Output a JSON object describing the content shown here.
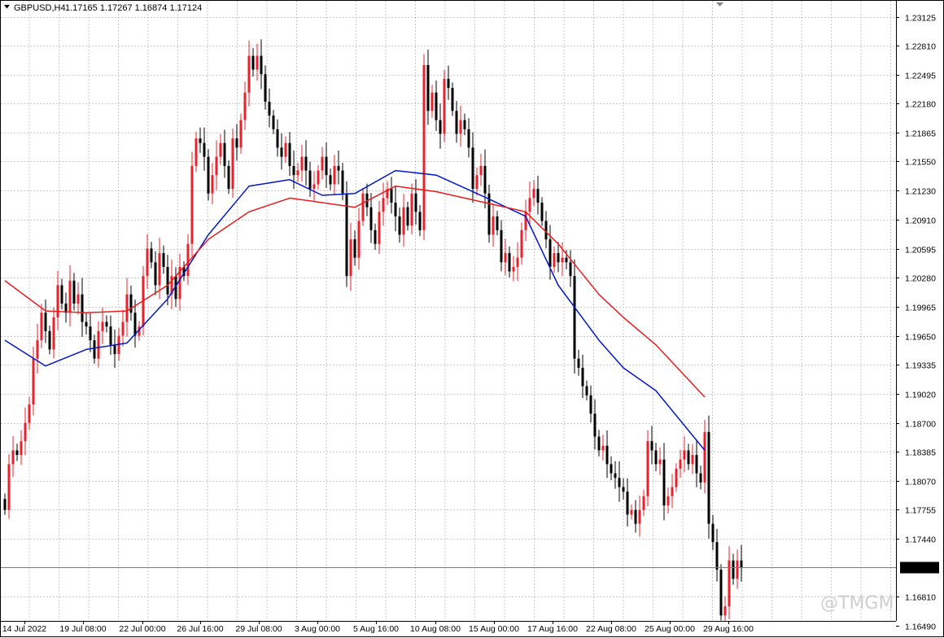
{
  "header": {
    "symbol": "GBPUSD,H4",
    "ohlc": "1.17165 1.17267 1.16874 1.17124"
  },
  "watermark": "@TMGM",
  "colors": {
    "bull": "#e8222c",
    "bear": "#000000",
    "ma_fast": "#0018c8",
    "ma_slow": "#e81c1c",
    "grid": "#c8c8c8",
    "axis": "#000000",
    "price_label_bg": "#000000",
    "price_label_text": "#ffffff"
  },
  "chart_data": {
    "type": "line",
    "title": "GBPUSD,H4",
    "ohlc_readout": {
      "open": 1.17165,
      "high": 1.17267,
      "low": 1.16874,
      "close": 1.17124
    },
    "current_price": "1.17124",
    "ylim": [
      1.1655,
      1.233
    ],
    "y_ticks": [
      "1.23125",
      "1.22810",
      "1.22495",
      "1.22180",
      "1.21865",
      "1.21550",
      "1.21230",
      "1.20910",
      "1.20595",
      "1.20280",
      "1.19965",
      "1.19650",
      "1.19335",
      "1.19020",
      "1.18700",
      "1.18385",
      "1.18070",
      "1.17755",
      "1.17440",
      "1.16810",
      "1.16490"
    ],
    "x_ticks": [
      "14 Jul 2022",
      "19 Jul 08:00",
      "22 Jul 00:00",
      "26 Jul 16:00",
      "29 Jul 08:00",
      "3 Aug 00:00",
      "5 Aug 16:00",
      "10 Aug 08:00",
      "15 Aug 00:00",
      "17 Aug 16:00",
      "22 Aug 08:00",
      "25 Aug 00:00",
      "29 Aug 16:00"
    ],
    "closes": [
      1.1775,
      1.1825,
      1.184,
      1.1835,
      1.185,
      1.187,
      1.189,
      1.194,
      1.196,
      1.199,
      1.197,
      1.195,
      1.1985,
      1.202,
      1.2,
      1.199,
      1.2025,
      1.2,
      1.201,
      1.198,
      1.1975,
      1.196,
      1.194,
      1.197,
      1.198,
      1.1975,
      1.1955,
      1.1945,
      1.1965,
      1.198,
      1.201,
      1.199,
      1.1965,
      1.1975,
      1.203,
      1.206,
      1.2045,
      1.202,
      1.2055,
      1.204,
      1.201,
      1.203,
      1.2005,
      1.204,
      1.203,
      1.2065,
      1.215,
      1.218,
      1.2175,
      1.216,
      1.212,
      1.214,
      1.216,
      1.2175,
      1.215,
      1.2125,
      1.218,
      1.217,
      1.22,
      1.223,
      1.227,
      1.2255,
      1.227,
      1.225,
      1.222,
      1.2205,
      1.219,
      1.217,
      1.216,
      1.2175,
      1.215,
      1.214,
      1.2145,
      1.216,
      1.2145,
      1.2125,
      1.213,
      1.2145,
      1.216,
      1.214,
      1.213,
      1.215,
      1.2145,
      1.212,
      1.203,
      1.207,
      1.205,
      1.209,
      1.212,
      1.2105,
      1.208,
      1.2065,
      1.21,
      1.2115,
      1.2125,
      1.211,
      1.2095,
      1.2075,
      1.2105,
      1.2085,
      1.212,
      1.21,
      1.208,
      1.226,
      1.221,
      1.223,
      1.22,
      1.2185,
      1.2245,
      1.2235,
      1.221,
      1.2185,
      1.22,
      1.219,
      1.217,
      1.2125,
      1.214,
      1.215,
      1.212,
      1.2075,
      1.2095,
      1.208,
      1.2045,
      1.2055,
      1.2035,
      1.204,
      1.205,
      1.208,
      1.21,
      1.2115,
      1.2125,
      1.211,
      1.209,
      1.207,
      1.204,
      1.2055,
      1.2045,
      1.205,
      1.2045,
      1.203,
      1.194,
      1.193,
      1.191,
      1.19,
      1.188,
      1.1855,
      1.184,
      1.1845,
      1.1825,
      1.1815,
      1.181,
      1.18,
      1.1795,
      1.177,
      1.1775,
      1.176,
      1.1775,
      1.179,
      1.185,
      1.184,
      1.1825,
      1.183,
      1.178,
      1.179,
      1.18,
      1.182,
      1.183,
      1.184,
      1.1825,
      1.1835,
      1.1815,
      1.1805,
      1.186,
      1.176,
      1.174,
      1.171,
      1.166,
      1.167,
      1.172,
      1.17,
      1.172,
      1.1712
    ],
    "series": [
      {
        "name": "",
        "color": "#0018c8",
        "x": [
          0,
          10,
          20,
          30,
          40,
          50,
          60,
          70,
          78,
          86,
          96,
          106,
          118,
          128,
          136,
          146,
          152,
          160,
          172
        ],
        "values": [
          1.196,
          1.1932,
          1.195,
          1.1957,
          1.2005,
          1.2075,
          1.2128,
          1.2135,
          1.2118,
          1.212,
          1.2145,
          1.214,
          1.2116,
          1.2095,
          1.202,
          1.196,
          1.193,
          1.1905,
          1.184
        ]
      },
      {
        "name": "",
        "color": "#e81c1c",
        "x": [
          0,
          10,
          20,
          30,
          40,
          50,
          60,
          70,
          78,
          86,
          96,
          106,
          118,
          128,
          136,
          146,
          152,
          160,
          172
        ],
        "values": [
          1.2025,
          1.1992,
          1.199,
          1.1992,
          1.202,
          1.207,
          1.21,
          1.2115,
          1.211,
          1.2105,
          1.2128,
          1.2122,
          1.211,
          1.21,
          1.2065,
          1.201,
          1.1985,
          1.1955,
          1.1898
        ]
      }
    ]
  }
}
